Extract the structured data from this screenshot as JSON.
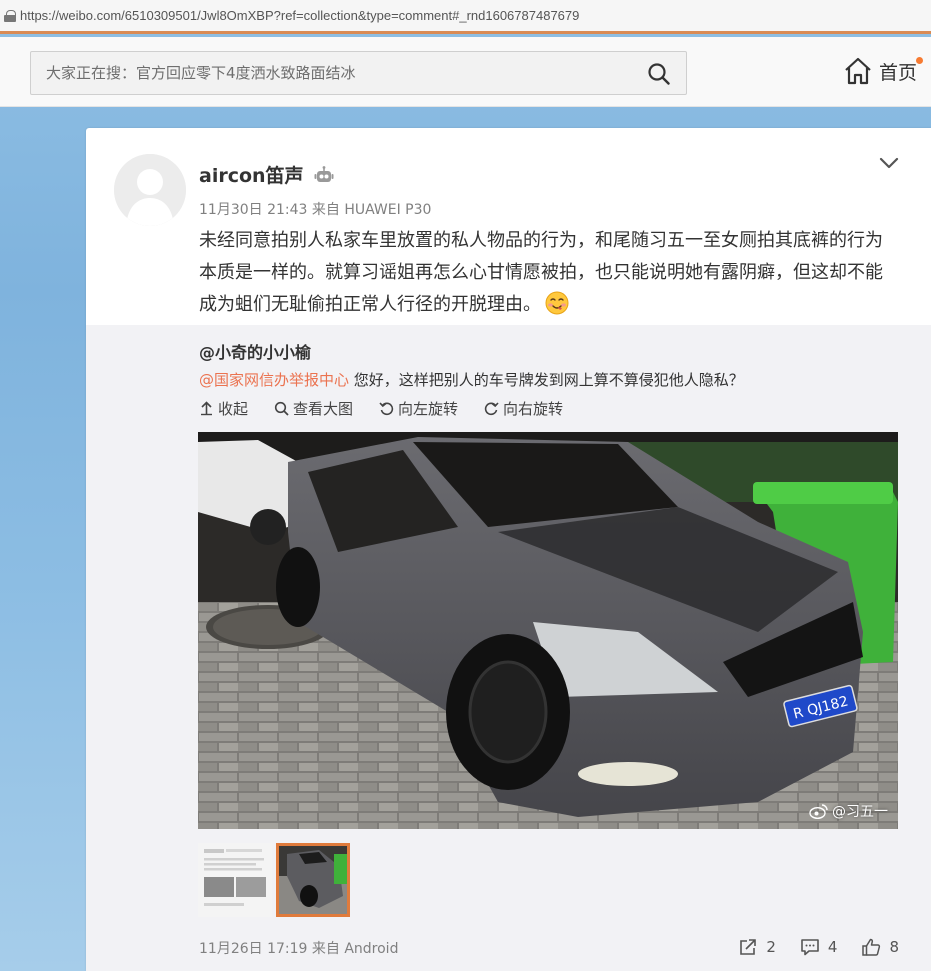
{
  "browser": {
    "url": "https://weibo.com/6510309501/Jwl8OmXBP?ref=collection&type=comment#_rnd1606787487679"
  },
  "topnav": {
    "search_placeholder": "大家正在搜：官方回应零下4度洒水致路面结冰",
    "home_label": "首页",
    "accent_color": "#f77b32"
  },
  "post": {
    "username": "aircon笛声",
    "meta": "11月30日 21:43 来自 HUAWEI P30",
    "content": "未经同意拍别人私家车里放置的私人物品的行为，和尾随习五一至女厕拍其底裤的行为本质是一样的。就算习谣姐再怎么心甘情愿被拍，也只能说明她有露阴癖，但这却不能成为蛆们无耻偷拍正常人行径的开脱理由。",
    "emoji": "yum-face-emoji",
    "repost": {
      "username": "@小奇的小小榆",
      "mention": "@国家网信办举报中心",
      "text": " 您好，这样把别人的车号牌发到网上算不算侵犯他人隐私？",
      "toolbar": {
        "collapse": "收起",
        "view_large": "查看大图",
        "rotate_left": "向左旋转",
        "rotate_right": "向右旋转"
      },
      "photo": {
        "plate": "R QJ182",
        "watermark": "@习五一"
      },
      "meta": "11月26日 17:19 来自 Android",
      "actions": {
        "forward": "2",
        "comment": "4",
        "like": "8"
      },
      "mention_color": "#eb7350",
      "selected_thumb_color": "#e07b3c"
    }
  }
}
